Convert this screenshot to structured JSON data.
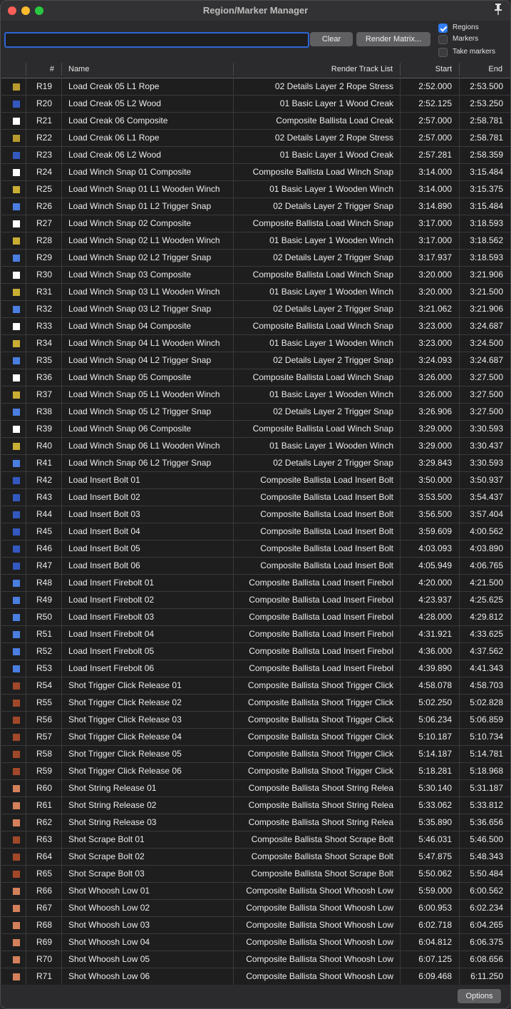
{
  "window": {
    "title": "Region/Marker Manager"
  },
  "toolbar": {
    "search_value": "",
    "clear_label": "Clear",
    "render_matrix_label": "Render Matrix...",
    "regions_label": "Regions",
    "regions_checked": true,
    "markers_label": "Markers",
    "markers_checked": false,
    "take_markers_label": "Take markers",
    "take_markers_checked": false
  },
  "columns": {
    "num": "#",
    "name": "Name",
    "track": "Render Track List",
    "start": "Start",
    "end": "End"
  },
  "colors": {
    "gold": "#b89a2e",
    "blue": "#3358c0",
    "white": "#ffffff",
    "yellow": "#c9ae34",
    "lightblue": "#4a7ee0",
    "brown": "#a2482a",
    "salmon": "#d4805a"
  },
  "rows": [
    {
      "color": "gold",
      "num": "R19",
      "name": "Load Creak 05 L1 Rope",
      "track": "02 Details Layer 2 Rope Stress",
      "start": "2:52.000",
      "end": "2:53.500"
    },
    {
      "color": "blue",
      "num": "R20",
      "name": "Load Creak 05 L2 Wood",
      "track": "01 Basic Layer 1 Wood Creak",
      "start": "2:52.125",
      "end": "2:53.250"
    },
    {
      "color": "white",
      "num": "R21",
      "name": "Load Creak 06 Composite",
      "track": "Composite Ballista Load Creak",
      "start": "2:57.000",
      "end": "2:58.781"
    },
    {
      "color": "gold",
      "num": "R22",
      "name": "Load Creak 06 L1 Rope",
      "track": "02 Details Layer 2 Rope Stress",
      "start": "2:57.000",
      "end": "2:58.781"
    },
    {
      "color": "blue",
      "num": "R23",
      "name": "Load Creak 06 L2 Wood",
      "track": "01 Basic Layer 1 Wood Creak",
      "start": "2:57.281",
      "end": "2:58.359"
    },
    {
      "color": "white",
      "num": "R24",
      "name": "Load Winch Snap 01 Composite",
      "track": "Composite Ballista Load Winch Snap",
      "start": "3:14.000",
      "end": "3:15.484"
    },
    {
      "color": "yellow",
      "num": "R25",
      "name": "Load Winch Snap 01 L1 Wooden Winch",
      "track": "01 Basic Layer 1 Wooden Winch",
      "start": "3:14.000",
      "end": "3:15.375"
    },
    {
      "color": "lightblue",
      "num": "R26",
      "name": "Load Winch Snap 01 L2 Trigger Snap",
      "track": "02 Details Layer 2 Trigger Snap",
      "start": "3:14.890",
      "end": "3:15.484"
    },
    {
      "color": "white",
      "num": "R27",
      "name": "Load Winch Snap 02 Composite",
      "track": "Composite Ballista Load Winch Snap",
      "start": "3:17.000",
      "end": "3:18.593"
    },
    {
      "color": "yellow",
      "num": "R28",
      "name": "Load Winch Snap 02 L1 Wooden Winch",
      "track": "01 Basic Layer 1 Wooden Winch",
      "start": "3:17.000",
      "end": "3:18.562"
    },
    {
      "color": "lightblue",
      "num": "R29",
      "name": "Load Winch Snap 02 L2 Trigger Snap",
      "track": "02 Details Layer 2 Trigger Snap",
      "start": "3:17.937",
      "end": "3:18.593"
    },
    {
      "color": "white",
      "num": "R30",
      "name": "Load Winch Snap 03 Composite",
      "track": "Composite Ballista Load Winch Snap",
      "start": "3:20.000",
      "end": "3:21.906"
    },
    {
      "color": "yellow",
      "num": "R31",
      "name": "Load Winch Snap 03 L1 Wooden Winch",
      "track": "01 Basic Layer 1 Wooden Winch",
      "start": "3:20.000",
      "end": "3:21.500"
    },
    {
      "color": "lightblue",
      "num": "R32",
      "name": "Load Winch Snap 03 L2 Trigger Snap",
      "track": "02 Details Layer 2 Trigger Snap",
      "start": "3:21.062",
      "end": "3:21.906"
    },
    {
      "color": "white",
      "num": "R33",
      "name": "Load Winch Snap 04 Composite",
      "track": "Composite Ballista Load Winch Snap",
      "start": "3:23.000",
      "end": "3:24.687"
    },
    {
      "color": "yellow",
      "num": "R34",
      "name": "Load Winch Snap 04 L1 Wooden Winch",
      "track": "01 Basic Layer 1 Wooden Winch",
      "start": "3:23.000",
      "end": "3:24.500"
    },
    {
      "color": "lightblue",
      "num": "R35",
      "name": "Load Winch Snap 04 L2 Trigger Snap",
      "track": "02 Details Layer 2 Trigger Snap",
      "start": "3:24.093",
      "end": "3:24.687"
    },
    {
      "color": "white",
      "num": "R36",
      "name": "Load Winch Snap 05 Composite",
      "track": "Composite Ballista Load Winch Snap",
      "start": "3:26.000",
      "end": "3:27.500"
    },
    {
      "color": "yellow",
      "num": "R37",
      "name": "Load Winch Snap 05 L1 Wooden Winch",
      "track": "01 Basic Layer 1 Wooden Winch",
      "start": "3:26.000",
      "end": "3:27.500"
    },
    {
      "color": "lightblue",
      "num": "R38",
      "name": "Load Winch Snap 05 L2 Trigger Snap",
      "track": "02 Details Layer 2 Trigger Snap",
      "start": "3:26.906",
      "end": "3:27.500"
    },
    {
      "color": "white",
      "num": "R39",
      "name": "Load Winch Snap 06 Composite",
      "track": "Composite Ballista Load Winch Snap",
      "start": "3:29.000",
      "end": "3:30.593"
    },
    {
      "color": "yellow",
      "num": "R40",
      "name": "Load Winch Snap 06 L1 Wooden Winch",
      "track": "01 Basic Layer 1 Wooden Winch",
      "start": "3:29.000",
      "end": "3:30.437"
    },
    {
      "color": "lightblue",
      "num": "R41",
      "name": "Load Winch Snap 06 L2 Trigger Snap",
      "track": "02 Details Layer 2 Trigger Snap",
      "start": "3:29.843",
      "end": "3:30.593"
    },
    {
      "color": "blue",
      "num": "R42",
      "name": "Load Insert Bolt 01",
      "track": "Composite Ballista Load Insert Bolt",
      "start": "3:50.000",
      "end": "3:50.937"
    },
    {
      "color": "blue",
      "num": "R43",
      "name": "Load Insert Bolt 02",
      "track": "Composite Ballista Load Insert Bolt",
      "start": "3:53.500",
      "end": "3:54.437"
    },
    {
      "color": "blue",
      "num": "R44",
      "name": "Load Insert Bolt 03",
      "track": "Composite Ballista Load Insert Bolt",
      "start": "3:56.500",
      "end": "3:57.404"
    },
    {
      "color": "blue",
      "num": "R45",
      "name": "Load Insert Bolt 04",
      "track": "Composite Ballista Load Insert Bolt",
      "start": "3:59.609",
      "end": "4:00.562"
    },
    {
      "color": "blue",
      "num": "R46",
      "name": "Load Insert Bolt 05",
      "track": "Composite Ballista Load Insert Bolt",
      "start": "4:03.093",
      "end": "4:03.890"
    },
    {
      "color": "blue",
      "num": "R47",
      "name": "Load Insert Bolt 06",
      "track": "Composite Ballista Load Insert Bolt",
      "start": "4:05.949",
      "end": "4:06.765"
    },
    {
      "color": "lightblue",
      "num": "R48",
      "name": "Load Insert Firebolt 01",
      "track": "Composite Ballista Load Insert Firebol",
      "start": "4:20.000",
      "end": "4:21.500"
    },
    {
      "color": "lightblue",
      "num": "R49",
      "name": "Load Insert Firebolt 02",
      "track": "Composite Ballista Load Insert Firebol",
      "start": "4:23.937",
      "end": "4:25.625"
    },
    {
      "color": "lightblue",
      "num": "R50",
      "name": "Load Insert Firebolt 03",
      "track": "Composite Ballista Load Insert Firebol",
      "start": "4:28.000",
      "end": "4:29.812"
    },
    {
      "color": "lightblue",
      "num": "R51",
      "name": "Load Insert Firebolt 04",
      "track": "Composite Ballista Load Insert Firebol",
      "start": "4:31.921",
      "end": "4:33.625"
    },
    {
      "color": "lightblue",
      "num": "R52",
      "name": "Load Insert Firebolt 05",
      "track": "Composite Ballista Load Insert Firebol",
      "start": "4:36.000",
      "end": "4:37.562"
    },
    {
      "color": "lightblue",
      "num": "R53",
      "name": "Load Insert Firebolt 06",
      "track": "Composite Ballista Load Insert Firebol",
      "start": "4:39.890",
      "end": "4:41.343"
    },
    {
      "color": "brown",
      "num": "R54",
      "name": "Shot Trigger Click Release 01",
      "track": "Composite Ballista Shoot Trigger Click",
      "start": "4:58.078",
      "end": "4:58.703"
    },
    {
      "color": "brown",
      "num": "R55",
      "name": "Shot Trigger Click Release 02",
      "track": "Composite Ballista Shoot Trigger Click",
      "start": "5:02.250",
      "end": "5:02.828"
    },
    {
      "color": "brown",
      "num": "R56",
      "name": "Shot Trigger Click Release 03",
      "track": "Composite Ballista Shoot Trigger Click",
      "start": "5:06.234",
      "end": "5:06.859"
    },
    {
      "color": "brown",
      "num": "R57",
      "name": "Shot Trigger Click Release 04",
      "track": "Composite Ballista Shoot Trigger Click",
      "start": "5:10.187",
      "end": "5:10.734"
    },
    {
      "color": "brown",
      "num": "R58",
      "name": "Shot Trigger Click Release 05",
      "track": "Composite Ballista Shoot Trigger Click",
      "start": "5:14.187",
      "end": "5:14.781"
    },
    {
      "color": "brown",
      "num": "R59",
      "name": "Shot Trigger Click Release 06",
      "track": "Composite Ballista Shoot Trigger Click",
      "start": "5:18.281",
      "end": "5:18.968"
    },
    {
      "color": "salmon",
      "num": "R60",
      "name": "Shot String Release 01",
      "track": "Composite Ballista Shoot String Relea",
      "start": "5:30.140",
      "end": "5:31.187"
    },
    {
      "color": "salmon",
      "num": "R61",
      "name": "Shot String Release 02",
      "track": "Composite Ballista Shoot String Relea",
      "start": "5:33.062",
      "end": "5:33.812"
    },
    {
      "color": "salmon",
      "num": "R62",
      "name": "Shot String Release 03",
      "track": "Composite Ballista Shoot String Relea",
      "start": "5:35.890",
      "end": "5:36.656"
    },
    {
      "color": "brown",
      "num": "R63",
      "name": "Shot Scrape Bolt 01",
      "track": "Composite Ballista Shoot Scrape Bolt",
      "start": "5:46.031",
      "end": "5:46.500"
    },
    {
      "color": "brown",
      "num": "R64",
      "name": "Shot Scrape Bolt 02",
      "track": "Composite Ballista Shoot Scrape Bolt",
      "start": "5:47.875",
      "end": "5:48.343"
    },
    {
      "color": "brown",
      "num": "R65",
      "name": "Shot Scrape Bolt 03",
      "track": "Composite Ballista Shoot Scrape Bolt",
      "start": "5:50.062",
      "end": "5:50.484"
    },
    {
      "color": "salmon",
      "num": "R66",
      "name": "Shot Whoosh Low 01",
      "track": "Composite Ballista Shoot Whoosh Low",
      "start": "5:59.000",
      "end": "6:00.562"
    },
    {
      "color": "salmon",
      "num": "R67",
      "name": "Shot Whoosh Low 02",
      "track": "Composite Ballista Shoot Whoosh Low",
      "start": "6:00.953",
      "end": "6:02.234"
    },
    {
      "color": "salmon",
      "num": "R68",
      "name": "Shot Whoosh Low 03",
      "track": "Composite Ballista Shoot Whoosh Low",
      "start": "6:02.718",
      "end": "6:04.265"
    },
    {
      "color": "salmon",
      "num": "R69",
      "name": "Shot Whoosh Low 04",
      "track": "Composite Ballista Shoot Whoosh Low",
      "start": "6:04.812",
      "end": "6:06.375"
    },
    {
      "color": "salmon",
      "num": "R70",
      "name": "Shot Whoosh Low 05",
      "track": "Composite Ballista Shoot Whoosh Low",
      "start": "6:07.125",
      "end": "6:08.656"
    },
    {
      "color": "salmon",
      "num": "R71",
      "name": "Shot Whoosh Low 06",
      "track": "Composite Ballista Shoot Whoosh Low",
      "start": "6:09.468",
      "end": "6:11.250"
    }
  ],
  "footer": {
    "options_label": "Options"
  }
}
